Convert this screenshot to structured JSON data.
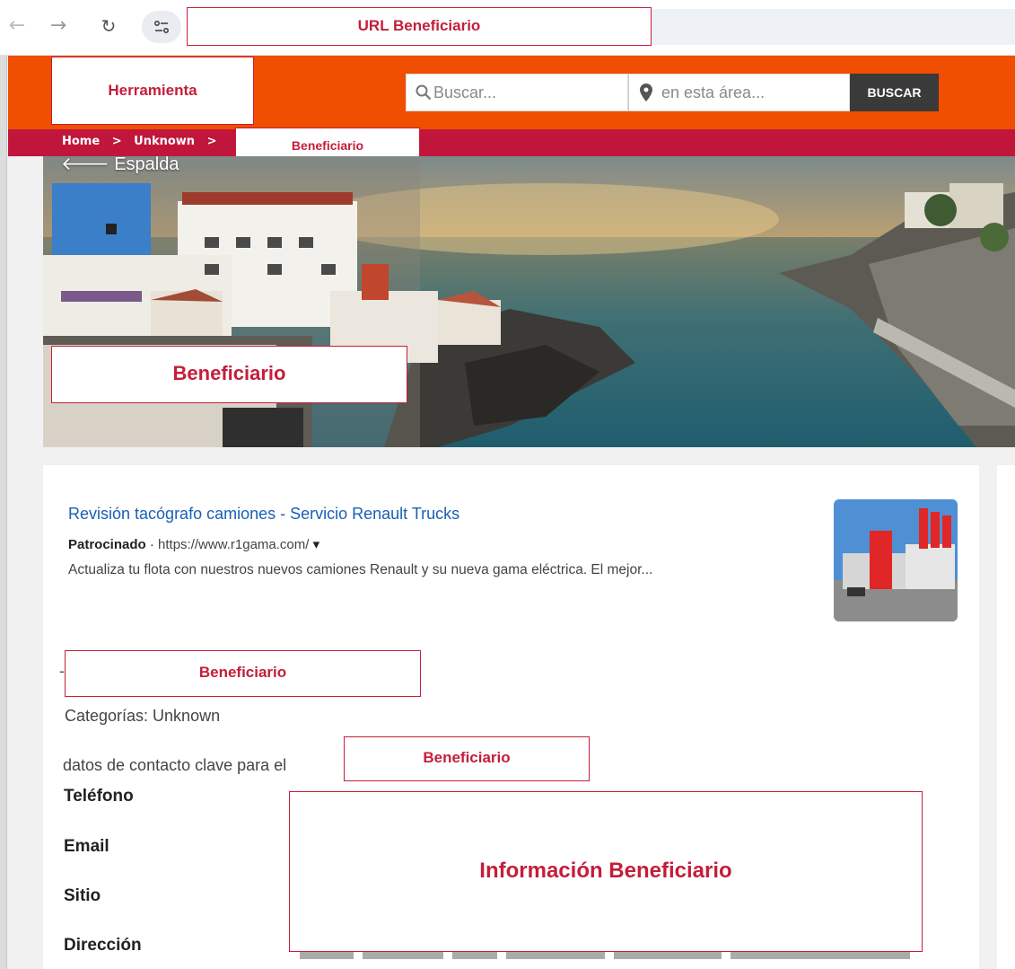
{
  "browser": {
    "back_icon": "arrow-left-icon",
    "forward_icon": "arrow-right-icon",
    "reload_icon": "reload-icon",
    "site_info_icon": "site-settings-icon",
    "url_annotation": "URL Beneficiario"
  },
  "header": {
    "tool_annotation": "Herramienta",
    "search_placeholder": "Buscar...",
    "location_placeholder": "en esta área...",
    "search_button": "BUSCAR"
  },
  "breadcrumb": {
    "home": "Home",
    "sep1": ">",
    "category": "Unknown",
    "sep2": ">",
    "annotation": "Beneficiario"
  },
  "hero": {
    "back_link": "Espalda",
    "annotation": "Beneficiario"
  },
  "ad": {
    "title": "Revisión tacógrafo camiones - Servicio Renault Trucks",
    "sponsored": "Patrocinado",
    "dot": "·",
    "url": "https://www.r1gama.com/",
    "caret": "▾",
    "description": "Actualiza tu flota con nuestros nuevos camiones Renault y su nueva gama eléctrica. El mejor..."
  },
  "listing": {
    "dash": "-",
    "name_annotation": "Beneficiario",
    "categories": "Categorías: Unknown",
    "contact_intro": "datos de contacto clave para el",
    "contact_annotation": "Beneficiario",
    "labels": {
      "phone": "Teléfono",
      "email": "Email",
      "site": "Sitio",
      "address": "Dirección"
    },
    "info_annotation": "Información Beneficiario"
  },
  "colors": {
    "header": "#f04e00",
    "breadcrumb": "#c1163c",
    "annotation": "#c41e3a",
    "link": "#1a5fb4"
  }
}
